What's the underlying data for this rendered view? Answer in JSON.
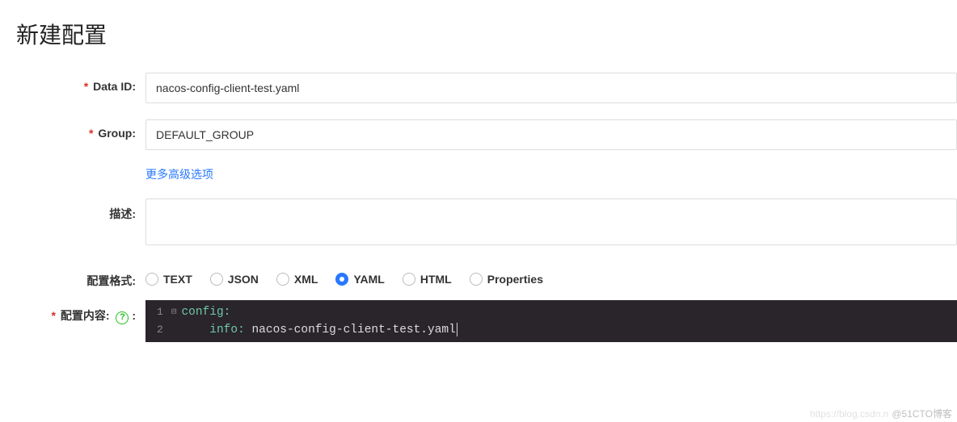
{
  "page": {
    "title": "新建配置"
  },
  "labels": {
    "data_id": "Data ID:",
    "group": "Group:",
    "more_options": "更多高级选项",
    "description": "描述:",
    "format": "配置格式:",
    "content": "配置内容:"
  },
  "fields": {
    "data_id": "nacos-config-client-test.yaml",
    "group": "DEFAULT_GROUP",
    "description": ""
  },
  "format_options": [
    {
      "label": "TEXT",
      "value": "text",
      "checked": false
    },
    {
      "label": "JSON",
      "value": "json",
      "checked": false
    },
    {
      "label": "XML",
      "value": "xml",
      "checked": false
    },
    {
      "label": "YAML",
      "value": "yaml",
      "checked": true
    },
    {
      "label": "HTML",
      "value": "html",
      "checked": false
    },
    {
      "label": "Properties",
      "value": "properties",
      "checked": false
    }
  ],
  "editor": {
    "line_numbers": [
      "1",
      "2"
    ],
    "fold_markers": [
      "⊟",
      ""
    ],
    "lines": [
      {
        "key": "config",
        "sep": ":",
        "value": "",
        "indent": ""
      },
      {
        "key": "info",
        "sep": ": ",
        "value": "nacos-config-client-test.yaml",
        "indent": "    "
      }
    ]
  },
  "watermark": {
    "faint": "https://blog.csdn.n",
    "text": "@51CTO博客"
  }
}
